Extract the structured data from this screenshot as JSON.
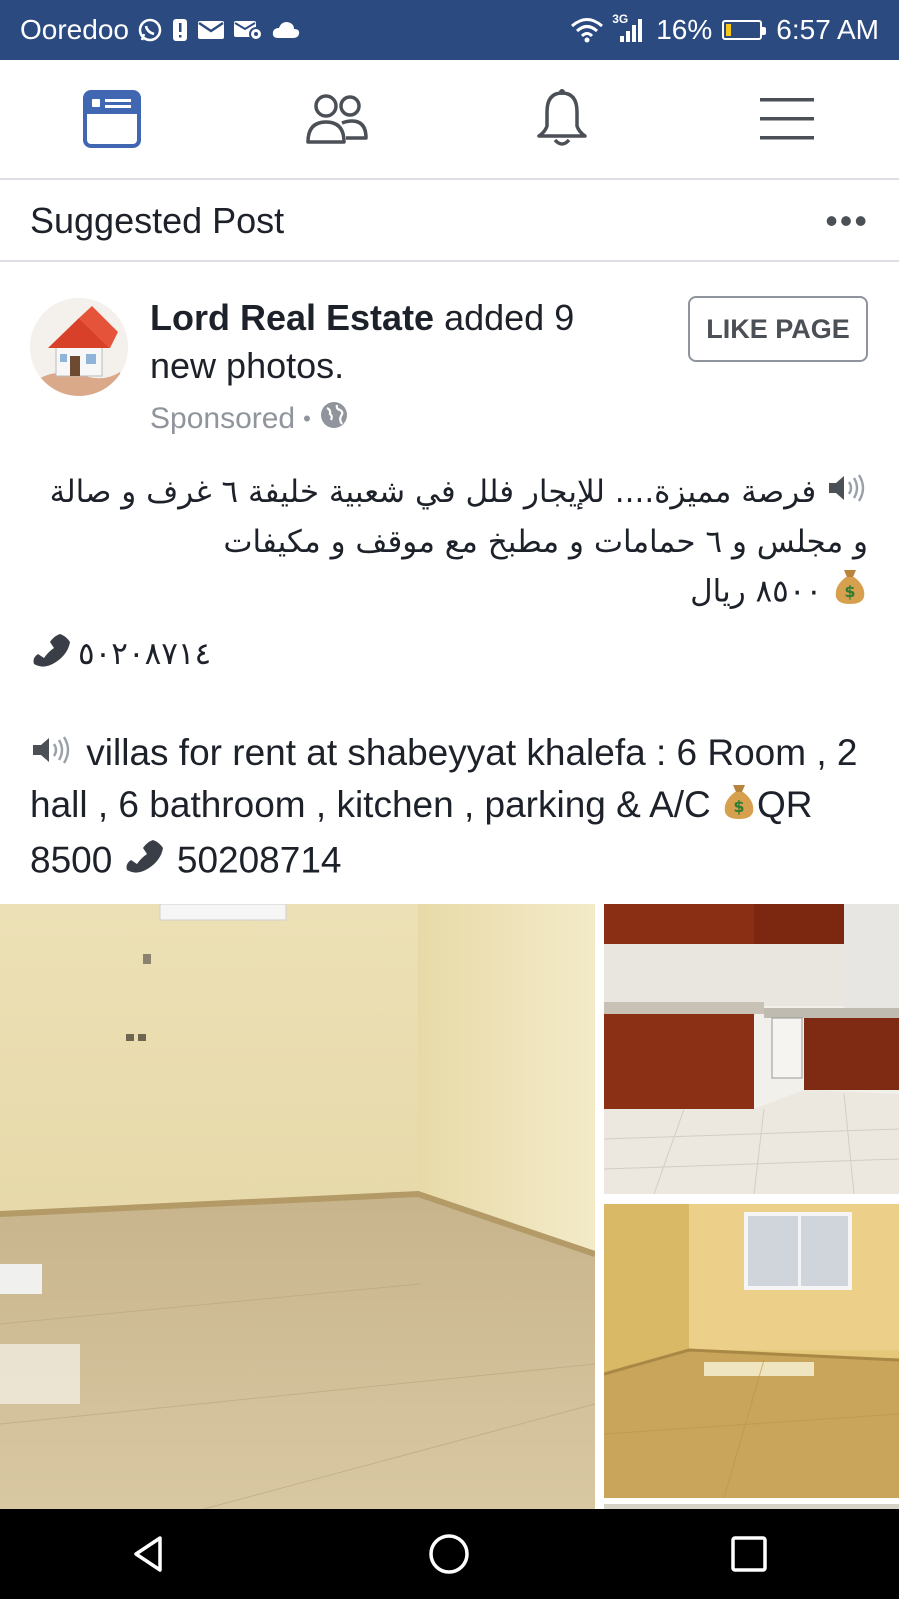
{
  "status_bar": {
    "carrier": "Ooredoo",
    "network": "3G",
    "battery": "16%",
    "battery_level": 0.16,
    "time": "6:57 AM"
  },
  "nav": {
    "items": [
      "news-feed-icon",
      "friends-icon",
      "notifications-icon",
      "menu-icon"
    ],
    "active": 0,
    "accent": "#4267b2"
  },
  "suggested": {
    "title": "Suggested Post",
    "more": "•••"
  },
  "post": {
    "author": "Lord Real Estate",
    "action": " added 9 new photos.",
    "sponsored": "Sponsored",
    "separator": "•",
    "like_label": "LIKE PAGE",
    "arabic_text": "فرصة مميزة.... للإيجار فلل في شعبية خليفة ٦ غرف و صالة و مجلس و ٦ حمامات و مطبخ مع موقف و مكيفات",
    "arabic_price": "٨٥٠٠ ريال",
    "arabic_phone": "٥٠٢٠٨٧١٤",
    "english_text": "villas for rent at shabeyyat khalefa : 6 Room , 2 hall , 6 bathroom , kitchen , parking & A/C",
    "english_price": "QR 8500",
    "english_phone": "50208714"
  },
  "colors": {
    "status_bar": "#2b4a80",
    "text": "#1d2129",
    "muted": "#90949c",
    "divider": "#dcdee3"
  }
}
